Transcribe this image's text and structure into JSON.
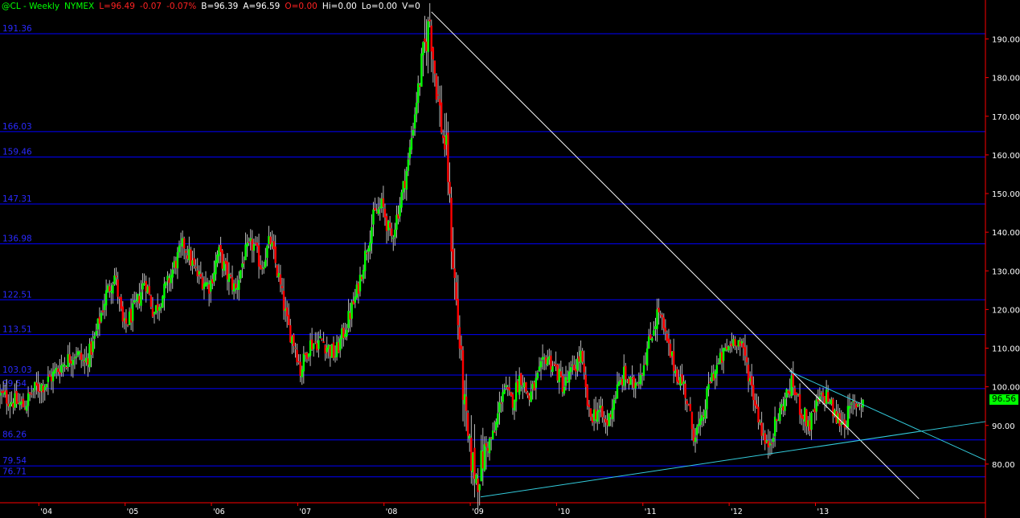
{
  "header": {
    "symbol": "@CL - Weekly",
    "exchange": "NYMEX",
    "last": "L=96.49",
    "change": "-0.07",
    "change_pct": "-0.07%",
    "bid": "B=96.39",
    "ask": "A=96.59",
    "open": "O=0.00",
    "hi": "Hi=0.00",
    "lo": "Lo=0.00",
    "vol": "V=0"
  },
  "colors": {
    "up": "#00ff00",
    "down": "#ff0000",
    "level_line": "#0000ff",
    "level_label": "#2a2aff",
    "axis": "#ff0000",
    "downtrend": "#ffffff",
    "support": "#33ccdd",
    "header_green": "#00ff00",
    "header_red": "#ff2222",
    "header_white": "#ffffff"
  },
  "last_price_tag": "96.56",
  "levels": [
    {
      "value": 191.36,
      "label": "191.36"
    },
    {
      "value": 166.03,
      "label": "166.03"
    },
    {
      "value": 159.46,
      "label": "159.46"
    },
    {
      "value": 147.31,
      "label": "147.31"
    },
    {
      "value": 136.98,
      "label": "136.98"
    },
    {
      "value": 122.51,
      "label": "122.51"
    },
    {
      "value": 113.51,
      "label": "113.51"
    },
    {
      "value": 103.03,
      "label": "103.03"
    },
    {
      "value": 99.54,
      "label": "99.54"
    },
    {
      "value": 86.26,
      "label": "86.26"
    },
    {
      "value": 79.54,
      "label": "79.54"
    },
    {
      "value": 76.71,
      "label": "76.71"
    }
  ],
  "chart_data": {
    "type": "candlestick",
    "title": "@CL - Weekly NYMEX",
    "ylim": [
      70,
      198
    ],
    "xlim": [
      2003.55,
      2014.97
    ],
    "y_ticks": [
      "190.00",
      "180.00",
      "170.00",
      "160.00",
      "150.00",
      "140.00",
      "130.00",
      "120.00",
      "110.00",
      "100.00",
      "90.00",
      "80.00"
    ],
    "y_tick_values": [
      190,
      180,
      170,
      160,
      150,
      140,
      130,
      120,
      110,
      100,
      90,
      80
    ],
    "x_ticks": [
      {
        "label": "'04",
        "t": 2004.0
      },
      {
        "label": "'05",
        "t": 2005.0
      },
      {
        "label": "'06",
        "t": 2006.0
      },
      {
        "label": "'07",
        "t": 2007.0
      },
      {
        "label": "'08",
        "t": 2008.0
      },
      {
        "label": "'09",
        "t": 2009.0
      },
      {
        "label": "'10",
        "t": 2010.0
      },
      {
        "label": "'11",
        "t": 2011.0
      },
      {
        "label": "'12",
        "t": 2012.0
      },
      {
        "label": "'13",
        "t": 2013.0
      }
    ],
    "price_path": [
      [
        2003.55,
        98
      ],
      [
        2003.85,
        95
      ],
      [
        2003.95,
        99
      ],
      [
        2004.1,
        101
      ],
      [
        2004.3,
        106
      ],
      [
        2004.45,
        109
      ],
      [
        2004.55,
        106
      ],
      [
        2004.65,
        111
      ],
      [
        2004.8,
        124
      ],
      [
        2004.9,
        129
      ],
      [
        2005.0,
        115
      ],
      [
        2005.15,
        121
      ],
      [
        2005.25,
        128
      ],
      [
        2005.35,
        119
      ],
      [
        2005.5,
        126
      ],
      [
        2005.6,
        132
      ],
      [
        2005.7,
        137
      ],
      [
        2005.85,
        129
      ],
      [
        2006.0,
        126
      ],
      [
        2006.1,
        135
      ],
      [
        2006.2,
        129
      ],
      [
        2006.3,
        125
      ],
      [
        2006.4,
        134
      ],
      [
        2006.5,
        137
      ],
      [
        2006.6,
        131
      ],
      [
        2006.7,
        138
      ],
      [
        2006.8,
        128
      ],
      [
        2006.9,
        116
      ],
      [
        2007.0,
        110
      ],
      [
        2007.05,
        104
      ],
      [
        2007.15,
        111
      ],
      [
        2007.3,
        112
      ],
      [
        2007.45,
        108
      ],
      [
        2007.6,
        117
      ],
      [
        2007.7,
        124
      ],
      [
        2007.8,
        134
      ],
      [
        2007.9,
        144
      ],
      [
        2008.0,
        147
      ],
      [
        2008.1,
        138
      ],
      [
        2008.2,
        147
      ],
      [
        2008.3,
        158
      ],
      [
        2008.4,
        175
      ],
      [
        2008.5,
        189
      ],
      [
        2008.55,
        195
      ],
      [
        2008.6,
        183
      ],
      [
        2008.7,
        165
      ],
      [
        2008.75,
        160
      ],
      [
        2008.8,
        138
      ],
      [
        2008.9,
        110
      ],
      [
        2008.95,
        95
      ],
      [
        2009.0,
        84
      ],
      [
        2009.1,
        76
      ],
      [
        2009.2,
        84
      ],
      [
        2009.3,
        88
      ],
      [
        2009.4,
        100
      ],
      [
        2009.5,
        96
      ],
      [
        2009.6,
        103
      ],
      [
        2009.7,
        97
      ],
      [
        2009.8,
        102
      ],
      [
        2009.9,
        108
      ],
      [
        2010.0,
        105
      ],
      [
        2010.1,
        100
      ],
      [
        2010.2,
        104
      ],
      [
        2010.3,
        108
      ],
      [
        2010.4,
        92
      ],
      [
        2010.5,
        94
      ],
      [
        2010.6,
        90
      ],
      [
        2010.7,
        98
      ],
      [
        2010.8,
        103
      ],
      [
        2010.9,
        100
      ],
      [
        2011.0,
        104
      ],
      [
        2011.1,
        112
      ],
      [
        2011.2,
        120
      ],
      [
        2011.3,
        111
      ],
      [
        2011.4,
        104
      ],
      [
        2011.5,
        100
      ],
      [
        2011.6,
        88
      ],
      [
        2011.7,
        90
      ],
      [
        2011.8,
        102
      ],
      [
        2011.9,
        106
      ],
      [
        2012.0,
        110
      ],
      [
        2012.1,
        113
      ],
      [
        2012.2,
        108
      ],
      [
        2012.3,
        98
      ],
      [
        2012.45,
        84
      ],
      [
        2012.55,
        90
      ],
      [
        2012.65,
        96
      ],
      [
        2012.75,
        101
      ],
      [
        2012.85,
        94
      ],
      [
        2012.95,
        90
      ],
      [
        2013.05,
        96
      ],
      [
        2013.15,
        98
      ],
      [
        2013.25,
        92
      ],
      [
        2013.35,
        91
      ],
      [
        2013.45,
        95
      ],
      [
        2013.55,
        96.5
      ]
    ],
    "trendlines": [
      {
        "name": "downtrend",
        "from": [
          2008.55,
          197
        ],
        "to": [
          2014.2,
          71
        ]
      },
      {
        "name": "support",
        "from": [
          2009.12,
          71.5
        ],
        "to": [
          2014.97,
          91
        ]
      },
      {
        "name": "resistance",
        "from": [
          2012.7,
          104
        ],
        "to": [
          2014.97,
          81
        ]
      }
    ]
  }
}
